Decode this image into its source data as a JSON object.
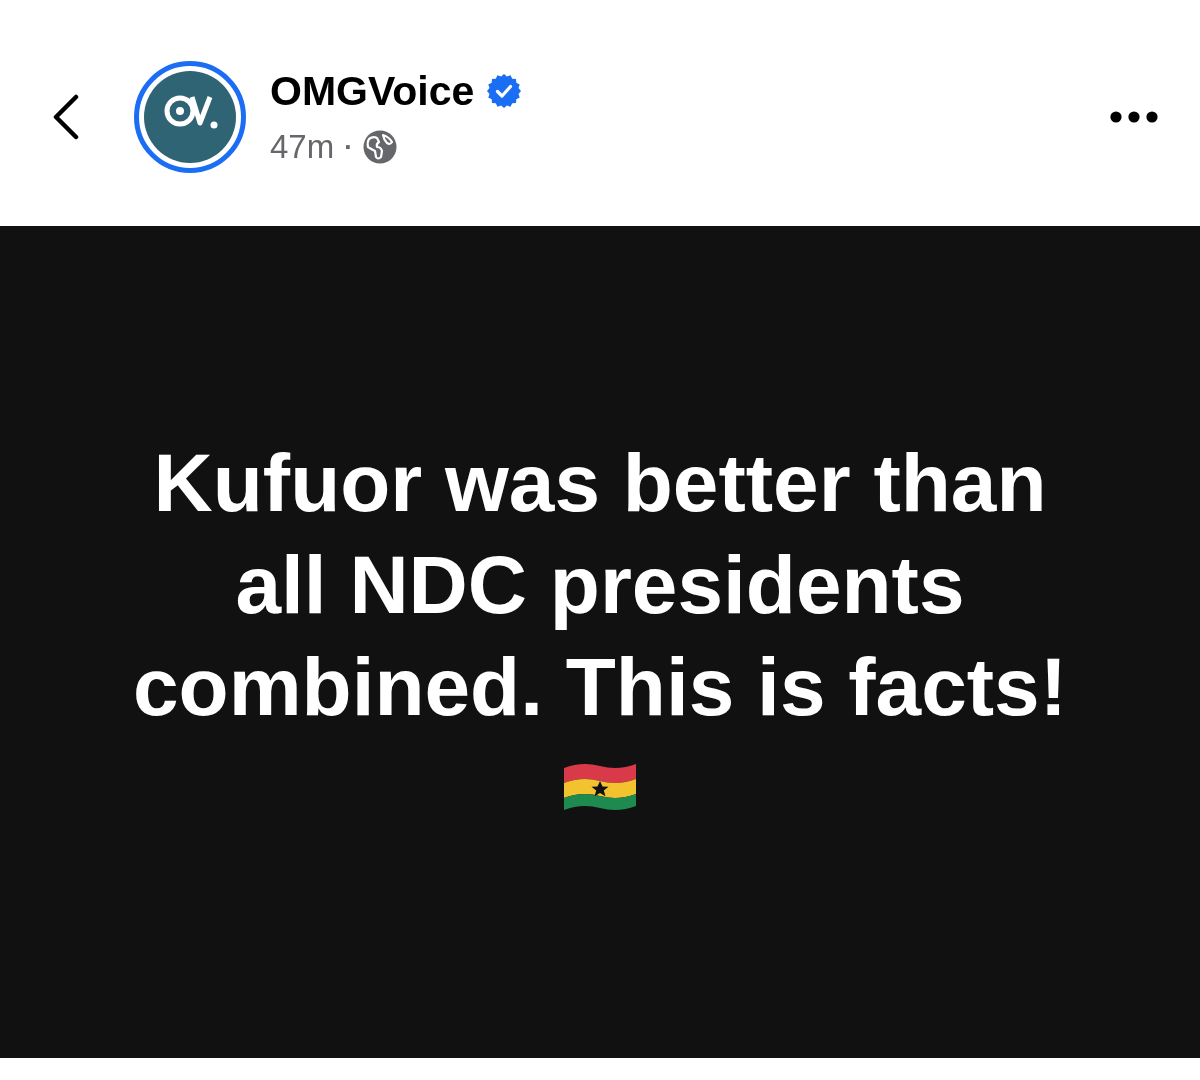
{
  "account": {
    "name": "OMGVoice",
    "verified": true,
    "has_story": true,
    "time": "47m",
    "separator": "·"
  },
  "post": {
    "text": "Kufuor was better than all NDC presidents combined. This is facts!"
  }
}
